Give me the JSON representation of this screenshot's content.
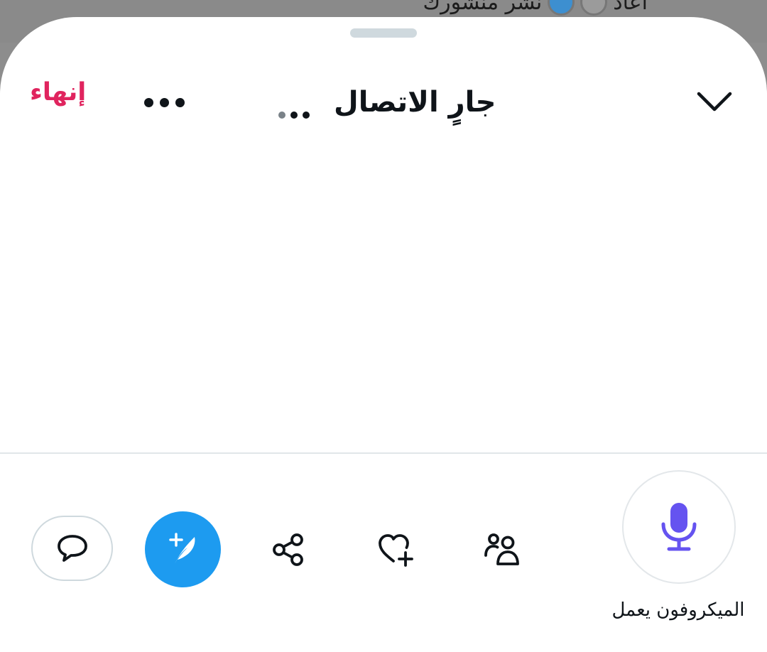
{
  "background_post": {
    "text_retweeted": "أعاد",
    "text_posted": "نشر منشورك"
  },
  "space": {
    "status_title": "جارٍ الاتصال",
    "end_label": "إنهاء",
    "more_icon": "more-horizontal-icon",
    "collapse_icon": "chevron-down-icon",
    "end_color": "#e0245e"
  },
  "controls": {
    "comment_icon": "speech-bubble-icon",
    "compose_icon": "feather-plus-icon",
    "share_icon": "share-icon",
    "like_icon": "heart-plus-icon",
    "people_icon": "people-icon",
    "mic_icon": "microphone-icon",
    "mic_label": "الميكروفون يعمل",
    "accent_color": "#1d9bf0",
    "mic_color": "#6553f0"
  }
}
